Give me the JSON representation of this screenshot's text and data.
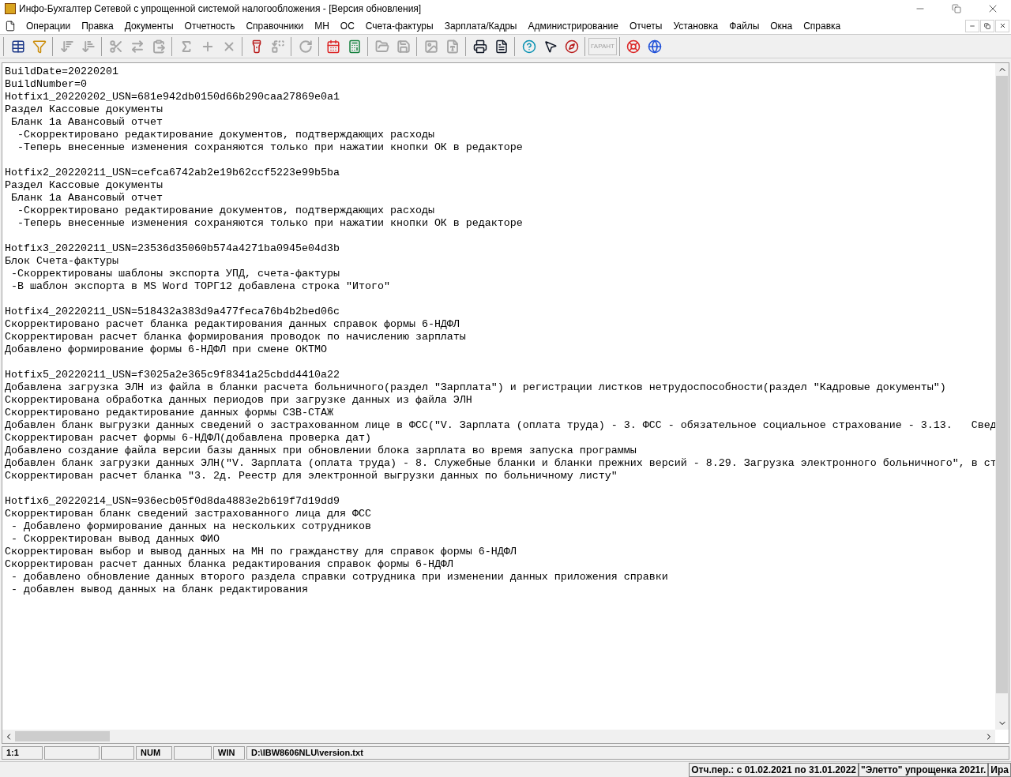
{
  "window": {
    "title": "Инфо-Бухгалтер Сетевой с упрощенной системой налогообложения - [Версия обновления]"
  },
  "menu": [
    "Операции",
    "Правка",
    "Документы",
    "Отчетность",
    "Справочники",
    "МН",
    "ОС",
    "Счета-фактуры",
    "Зарплата/Кадры",
    "Администрирование",
    "Отчеты",
    "Установка",
    "Файлы",
    "Окна",
    "Справка"
  ],
  "toolbar": {
    "groups": [
      [
        {
          "kind": "icon",
          "disabled": false
        },
        {
          "kind": "icon",
          "disabled": false
        }
      ],
      [
        {
          "kind": "icon",
          "disabled": true
        },
        {
          "kind": "icon",
          "disabled": true
        }
      ],
      [
        {
          "kind": "icon",
          "disabled": true
        },
        {
          "kind": "icon",
          "disabled": true
        },
        {
          "kind": "icon",
          "disabled": true
        }
      ],
      [
        {
          "kind": "icon",
          "disabled": true
        },
        {
          "kind": "icon",
          "disabled": true
        },
        {
          "kind": "icon",
          "disabled": true
        }
      ],
      [
        {
          "kind": "icon",
          "disabled": false
        },
        {
          "kind": "icon",
          "disabled": true
        }
      ],
      [
        {
          "kind": "icon",
          "disabled": true
        }
      ],
      [
        {
          "kind": "icon",
          "disabled": false
        },
        {
          "kind": "icon",
          "disabled": false
        }
      ],
      [
        {
          "kind": "icon",
          "disabled": true
        },
        {
          "kind": "icon",
          "disabled": true
        }
      ],
      [
        {
          "kind": "icon",
          "disabled": true
        },
        {
          "kind": "icon",
          "disabled": true
        }
      ],
      [
        {
          "kind": "icon",
          "disabled": false
        },
        {
          "kind": "icon",
          "disabled": false
        }
      ],
      [
        {
          "kind": "icon",
          "disabled": false
        },
        {
          "kind": "icon",
          "disabled": false
        },
        {
          "kind": "icon",
          "disabled": false
        }
      ],
      [
        {
          "kind": "text",
          "label": "ГАРАНТ",
          "disabled": true
        }
      ],
      [
        {
          "kind": "icon",
          "disabled": false
        },
        {
          "kind": "icon",
          "disabled": false
        }
      ]
    ]
  },
  "document": {
    "blocks": [
      [
        "BuildDate=20220201",
        "BuildNumber=0",
        "Hotfix1_20220202_USN=681e942db0150d66b290caa27869e0a1",
        "Раздел Кассовые документы",
        " Бланк 1а Авансовый отчет",
        "  -Скорректировано редактирование документов, подтверждающих расходы",
        "  -Теперь внесенные изменения сохраняются только при нажатии кнопки ОК в редакторе"
      ],
      [
        "Hotfix2_20220211_USN=cefca6742ab2e19b62ccf5223e99b5ba",
        "Раздел Кассовые документы",
        " Бланк 1а Авансовый отчет",
        "  -Скорректировано редактирование документов, подтверждающих расходы",
        "  -Теперь внесенные изменения сохраняются только при нажатии кнопки ОК в редакторе"
      ],
      [
        "Hotfix3_20220211_USN=23536d35060b574a4271ba0945e04d3b",
        "Блок Счета-фактуры",
        " -Скорректированы шаблоны экспорта УПД, счета-фактуры",
        " -В шаблон экспорта в MS Word ТОРГ12 добавлена строка \"Итого\""
      ],
      [
        "Hotfix4_20220211_USN=518432a383d9a477feca76b4b2bed06c",
        "Скорректировано расчет бланка редактирования данных справок формы 6-НДФЛ",
        "Скорректирован расчет бланка формирования проводок по начислению зарплаты",
        "Добавлено формирование формы 6-НДФЛ при смене ОКТМО"
      ],
      [
        "Hotfix5_20220211_USN=f3025a2e365c9f8341a25cbdd4410a22",
        "Добавлена загрузка ЭЛН из файла в бланки расчета больничного(раздел \"Зарплата\") и регистрации листков нетрудоспособности(раздел \"Кадровые документы\")",
        "Скорректирована обработка данных периодов при загрузке данных из файла ЭЛН",
        "Скорректировано редактирование данных формы СЗВ-СТАЖ",
        "Добавлен бланк выгрузки данных сведений о застрахованном лице в ФСС(\"V. Зарплата (оплата труда) - 3. ФСС - обязательное социальное страхование - 3.13.   Свед",
        "Скорректирован расчет формы 6-НДФЛ(добавлена проверка дат)",
        "Добавлено создание файла версии базы данных при обновлении блока зарплата во время запуска программы",
        "Добавлен бланк загрузки данных ЭЛН(\"V. Зарплата (оплата труда) - 8. Служебные бланки и бланки прежних версий - 8.29. Загрузка электронного больничного\", в ст",
        "Скорректирован расчет бланка \"3. 2д. Реестр для электронной выгрузки данных по больничному листу\""
      ],
      [
        "Hotfix6_20220214_USN=936ecb05f0d8da4883e2b619f7d19dd9",
        "Скорректирован бланк сведений застрахованного лица для ФСС",
        " - Добавлено формирование данных на нескольких сотрудников",
        " - Скорректирован вывод данных ФИО",
        "Скорректирован выбор и вывод данных на МН по гражданству для справок формы 6-НДФЛ",
        "Скорректирован расчет данных бланка редактирования справок формы 6-НДФЛ",
        " - добавлено обновление данных второго раздела справки сотрудника при изменении данных приложения справки",
        " - добавлен вывод данных на бланк редактирования"
      ]
    ]
  },
  "status_bar": {
    "cells": [
      "1:1",
      "",
      "",
      "NUM",
      "",
      "WIN",
      "D:\\IBW8606NLU\\version.txt"
    ]
  },
  "info_bar": [
    "Отч.пер.: с 01.02.2021 по 31.01.2022",
    "\"Элетто\" упрощенка 2021г.",
    "Ира"
  ]
}
